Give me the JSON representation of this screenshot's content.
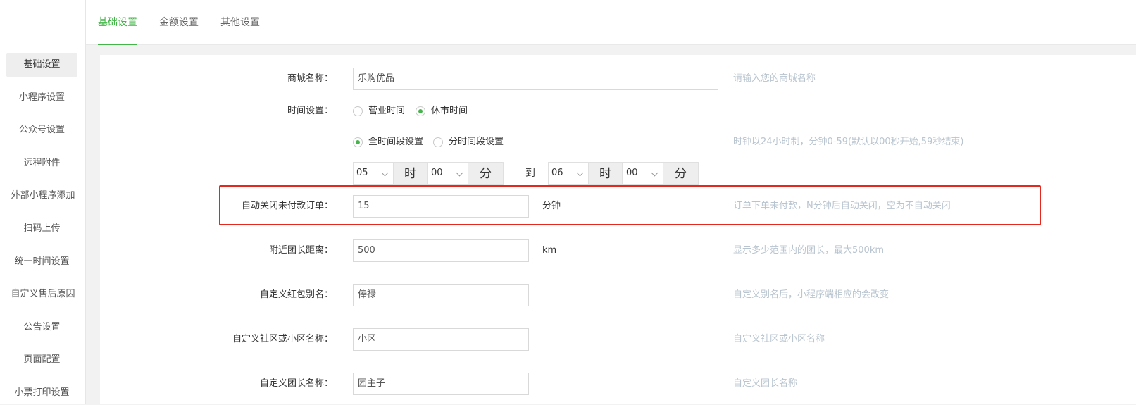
{
  "sidebar": {
    "items": [
      {
        "label": "基础设置",
        "active": true
      },
      {
        "label": "小程序设置"
      },
      {
        "label": "公众号设置"
      },
      {
        "label": "远程附件"
      },
      {
        "label": "外部小程序添加"
      },
      {
        "label": "扫码上传"
      },
      {
        "label": "统一时间设置"
      },
      {
        "label": "自定义售后原因"
      },
      {
        "label": "公告设置"
      },
      {
        "label": "页面配置"
      },
      {
        "label": "小票打印设置"
      }
    ]
  },
  "tabs": [
    {
      "label": "基础设置",
      "active": true
    },
    {
      "label": "金额设置"
    },
    {
      "label": "其他设置"
    }
  ],
  "form": {
    "shop_name": {
      "label": "商城名称",
      "value": "乐购优品",
      "hint": "请输入您的商城名称"
    },
    "time_setting": {
      "label": "时间设置",
      "mode_options": [
        {
          "label": "营业时间",
          "checked": false
        },
        {
          "label": "休市时间",
          "checked": true
        }
      ],
      "period_options": [
        {
          "label": "全时间段设置",
          "checked": true
        },
        {
          "label": "分时间段设置",
          "checked": false
        }
      ],
      "hint": "时钟以24小时制，分钟0-59(默认以00秒开始,59秒结束)",
      "start_hour": "05",
      "start_minute": "00",
      "end_hour": "06",
      "end_minute": "00",
      "hour_addon": "时",
      "minute_addon": "分",
      "to_label": "到"
    },
    "auto_close": {
      "label": "自动关闭未付款订单",
      "value": "15",
      "unit": "分钟",
      "hint": "订单下单未付款，N分钟后自动关闭，空为不自动关闭"
    },
    "nearby_distance": {
      "label": "附近团长距离",
      "value": "500",
      "unit": "km",
      "hint": "显示多少范围内的团长，最大500km"
    },
    "redpacket_alias": {
      "label": "自定义红包别名",
      "value": "俸禄",
      "hint": "自定义别名后，小程序端相应的会改变"
    },
    "community_name": {
      "label": "自定义社区或小区名称",
      "value": "小区",
      "hint": "自定义社区或小区名称"
    },
    "leader_name": {
      "label": "自定义团长名称",
      "value": "团主子",
      "hint": "自定义团长名称"
    }
  },
  "colors": {
    "accent": "#44b549",
    "highlight_border": "#e5281f",
    "hint": "#b8c4cf"
  }
}
